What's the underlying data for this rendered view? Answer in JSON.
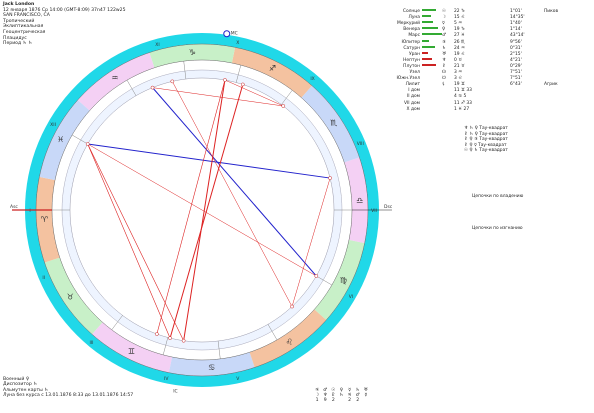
{
  "header": {
    "name": "Jack London",
    "datetime": "12 января 1876  Ср  14:00 (GMT-8:09) 37n47  122w25",
    "place": "SAN FRANCISCO, CA",
    "lines": [
      "Тропический",
      "Эклиптикальная",
      "Геоцентрическая",
      "Плацидус",
      "Период  ♄ ♄"
    ]
  },
  "chart": {
    "house_labels": [
      "XI",
      "X",
      "IX",
      "VIII",
      "VII",
      "VI",
      "V",
      "IV",
      "III",
      "II",
      "I",
      "XII"
    ],
    "asc_label": "Asc",
    "dsc_label": "Dsc",
    "ic_label": "IC",
    "mc_label": "MC",
    "zodiac_glyphs": [
      "♈",
      "♉",
      "♊",
      "♋",
      "♌",
      "♍",
      "♎",
      "♏",
      "♐",
      "♑",
      "♒",
      "♓"
    ],
    "colors": {
      "outer_ring": "#20d8e8",
      "fire": "#f4c2a0",
      "earth": "#c8f0c8",
      "air": "#f4d0f4",
      "water": "#c8d8f8",
      "aspect_red": "#dd2222",
      "aspect_blue": "#2222cc"
    }
  },
  "planets": {
    "header": [
      "Знак",
      "R",
      "D",
      "F",
      "T"
    ],
    "rows": [
      {
        "name": "Солнце",
        "glyph": "☉",
        "deg": "22 ♑",
        "pos": "1°01'",
        "note": "Пиков",
        "bar": "#3a3",
        "barw": 14
      },
      {
        "name": "Луна",
        "glyph": "☽",
        "deg": "15 ♌",
        "pos": "14°35'",
        "note": "",
        "bar": "#3a3",
        "barw": 9
      },
      {
        "name": "Меркурий",
        "glyph": "☿",
        "deg": "5 ♒",
        "pos": "1°40'",
        "note": "",
        "bar": "#3a3",
        "barw": 11
      },
      {
        "name": "Венера",
        "glyph": "♀",
        "deg": "19 ♑",
        "pos": "1°14'",
        "note": "",
        "bar": "#3a3",
        "barw": 16
      },
      {
        "name": "Марс",
        "glyph": "♂",
        "deg": "27 ♓",
        "pos": "43°14'",
        "note": "",
        "bar": "#3a3",
        "barw": 20
      },
      {
        "name": "Юпитер",
        "glyph": "♃",
        "deg": "26 ♏",
        "pos": "9°56'",
        "note": "",
        "bar": "#3a3",
        "barw": 7
      },
      {
        "name": "Сатурн",
        "glyph": "♄",
        "deg": "24 ♒",
        "pos": "0°31'",
        "note": "",
        "bar": "#3a3",
        "barw": 13
      },
      {
        "name": "Уран",
        "glyph": "♅",
        "deg": "19 ♌",
        "pos": "2°15'",
        "note": "",
        "bar": "#c22",
        "barw": 6
      },
      {
        "name": "Нептун",
        "glyph": "♆",
        "deg": "0 ♉",
        "pos": "4°21'",
        "note": "",
        "bar": "#c22",
        "barw": 10
      },
      {
        "name": "Плутон",
        "glyph": "♇",
        "deg": "21 ♉",
        "pos": "0°29'",
        "note": "",
        "bar": "#c22",
        "barw": 14
      },
      {
        "name": "Узел",
        "glyph": "☊",
        "deg": "3 ♒",
        "pos": "7°51'",
        "note": "",
        "bar": "",
        "barw": 0
      },
      {
        "name": "Южн.Узел",
        "glyph": "☋",
        "deg": "3 ♌",
        "pos": "7°51'",
        "note": "",
        "bar": "",
        "barw": 0
      },
      {
        "name": "Лилит",
        "glyph": "⚸",
        "deg": "19 ♊",
        "pos": "6°43'",
        "note": "Агрик",
        "bar": "",
        "barw": 0
      },
      {
        "name": "I дом",
        "glyph": "",
        "deg": "11 ♊ 33",
        "pos": "",
        "note": "",
        "bar": "",
        "barw": 0
      },
      {
        "name": "II дом",
        "glyph": "",
        "deg": "4 ♋ 5",
        "pos": "",
        "note": "",
        "bar": "",
        "barw": 0
      },
      {
        "name": "VII дом",
        "glyph": "",
        "deg": "11 ♐ 33",
        "pos": "",
        "note": "",
        "bar": "",
        "barw": 0
      },
      {
        "name": "X дом",
        "glyph": "",
        "deg": "1 ♓ 27",
        "pos": "",
        "note": "",
        "bar": "",
        "barw": 0
      }
    ]
  },
  "aspects": {
    "lines": [
      "♆ ♄ ♀  Тау-квадрат",
      "♇ ♄ ♀  Тау-квадрат",
      "♇ ♀ ♃  Тау-квадрат",
      "♇ ♀ ☿  Тау-квадрат",
      "☉ ♀ ♄  Тау-квадрат"
    ],
    "chain1_title": "Цепочки по владению",
    "chain2_title": "Цепочки по изгнанию"
  },
  "footer": {
    "lines": [
      "Военный  ♀",
      "Диспозитор  ♄",
      "Альмутен карты  ♄",
      "Луна без курса с 13.01.1876  8:33 до 13.01.1876 14:57"
    ],
    "table_top": [
      "♃",
      "♂",
      "☉",
      "♀",
      "☿",
      "♄",
      "♅"
    ],
    "table_mid": [
      "☽",
      "♆",
      "♇",
      "♄",
      "♃",
      "♂",
      "☿"
    ],
    "table_nums": [
      "1",
      "9",
      "2",
      "",
      "2",
      "2",
      ""
    ]
  }
}
